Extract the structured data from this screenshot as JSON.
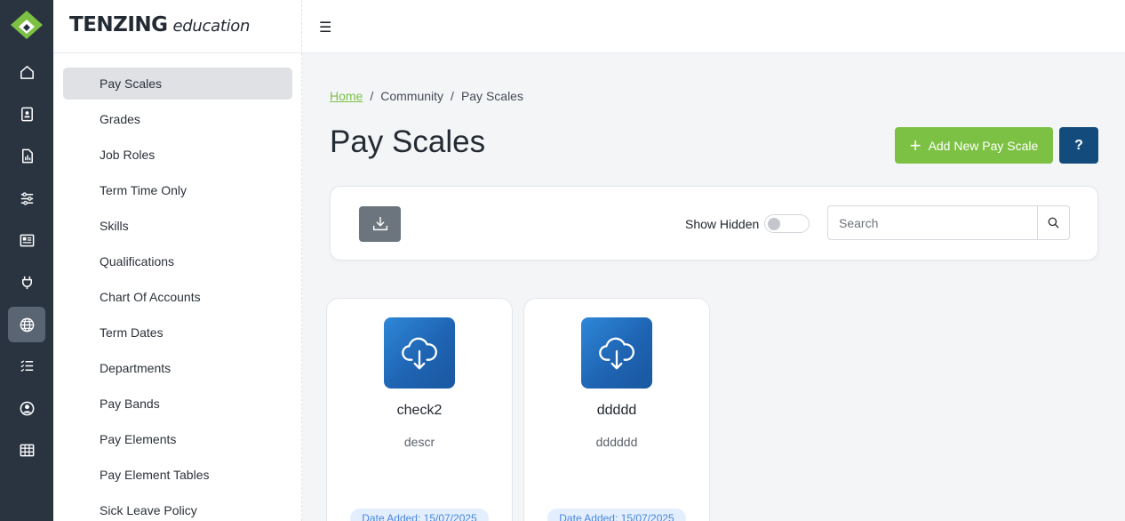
{
  "brand": {
    "main": "TENZING",
    "sub": "education",
    "logo_icon": "tenzing-logo-icon"
  },
  "rail": {
    "items": [
      {
        "name": "home",
        "icon": "home-icon"
      },
      {
        "name": "profile",
        "icon": "id-badge-icon"
      },
      {
        "name": "reports",
        "icon": "report-icon"
      },
      {
        "name": "settings",
        "icon": "sliders-icon"
      },
      {
        "name": "news",
        "icon": "newspaper-icon"
      },
      {
        "name": "integrations",
        "icon": "plug-icon"
      },
      {
        "name": "community",
        "icon": "globe-icon",
        "active": true
      },
      {
        "name": "lists",
        "icon": "list-icon"
      },
      {
        "name": "users",
        "icon": "user-circle-icon"
      },
      {
        "name": "tables",
        "icon": "table-icon"
      }
    ]
  },
  "sidebar": {
    "items": [
      {
        "label": "Pay Scales",
        "active": true
      },
      {
        "label": "Grades"
      },
      {
        "label": "Job Roles"
      },
      {
        "label": "Term Time Only"
      },
      {
        "label": "Skills"
      },
      {
        "label": "Qualifications"
      },
      {
        "label": "Chart Of Accounts"
      },
      {
        "label": "Term Dates"
      },
      {
        "label": "Departments"
      },
      {
        "label": "Pay Bands"
      },
      {
        "label": "Pay Elements"
      },
      {
        "label": "Pay Element Tables"
      },
      {
        "label": "Sick Leave Policy"
      }
    ]
  },
  "topbar": {
    "menu_icon": "hamburger-icon",
    "menu_glyph": "☰"
  },
  "breadcrumb": {
    "home": "Home",
    "sep1": "/",
    "level1": "Community",
    "sep2": "/",
    "current": "Pay Scales"
  },
  "page": {
    "title": "Pay Scales",
    "add_button": "Add New Pay Scale",
    "add_plus": "+",
    "help_button": "?"
  },
  "toolbar": {
    "show_hidden_label": "Show Hidden",
    "show_hidden_on": false,
    "search_placeholder": "Search",
    "search_value": ""
  },
  "cards": [
    {
      "name": "check2",
      "description": "descr",
      "date_added": "Date Added: 15/07/2025",
      "icon": "cloud-download-icon"
    },
    {
      "name": "ddddd",
      "description": "dddddd",
      "date_added": "Date Added: 15/07/2025",
      "icon": "cloud-download-icon"
    }
  ],
  "colors": {
    "accent_green": "#7cc143",
    "help_blue": "#134b7c",
    "rail_bg": "#2a3441",
    "card_icon_blue": "#1e64b2"
  }
}
